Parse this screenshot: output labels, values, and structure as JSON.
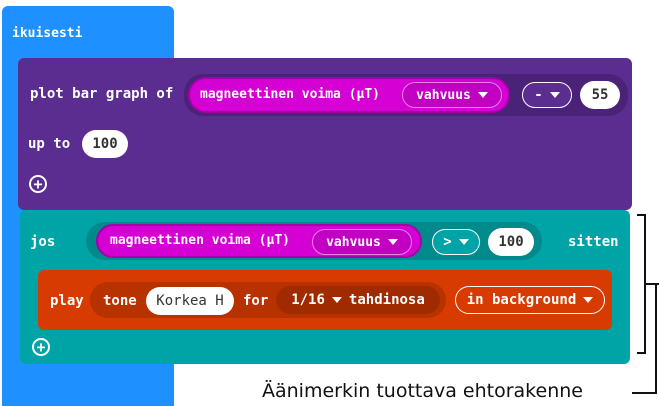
{
  "forever": {
    "label": "ikuisesti"
  },
  "plot_bar_graph": {
    "label": "plot bar graph of",
    "sensor": {
      "label": "magneettinen voima (µT)",
      "dropdown": "vahvuus"
    },
    "operator": "-",
    "operand": "55",
    "up_to_label": "up to",
    "up_to_value": "100"
  },
  "if_block": {
    "if_label": "jos",
    "sensor": {
      "label": "magneettinen voima (µT)",
      "dropdown": "vahvuus"
    },
    "comparator": ">",
    "compare_value": "100",
    "then_label": "sitten"
  },
  "play_block": {
    "play_label": "play",
    "tone_label": "tone",
    "note": "Korkea H",
    "for_label": "for",
    "duration": "1/16",
    "duration_unit": "tahdinosa",
    "mode": "in background"
  },
  "annotation": {
    "label": "Äänimerkin tuottava ehtorakenne"
  },
  "colors": {
    "loops": "#1e90ff",
    "led": "#5c2d91",
    "input": "#d400d4",
    "logic": "#00a4a6",
    "music": "#d83b01"
  }
}
